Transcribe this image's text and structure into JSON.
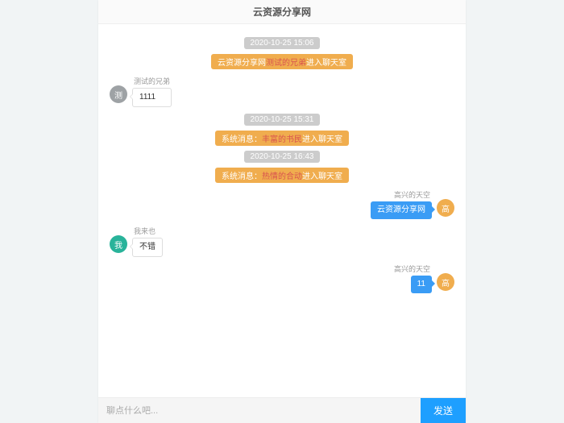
{
  "header": {
    "title": "云资源分享网"
  },
  "timeline": [
    {
      "kind": "sys",
      "style": "gray",
      "text": "2020-10-25 15:06"
    },
    {
      "kind": "sys",
      "style": "orange",
      "prefix": "云资源分享网",
      "hl": "测试的兄弟",
      "suffix": "进入聊天室"
    },
    {
      "kind": "msg",
      "side": "left",
      "avatarText": "测",
      "avatarClass": "av-gray",
      "name": "测试的兄弟",
      "bubbleClass": "b-gray",
      "text": "1111"
    },
    {
      "kind": "sys",
      "style": "gray",
      "text": "2020-10-25 15:31"
    },
    {
      "kind": "sys",
      "style": "orange",
      "prefix": "系统消息：",
      "hl": "丰富的书民",
      "suffix": "进入聊天室"
    },
    {
      "kind": "sys",
      "style": "gray",
      "text": "2020-10-25 16:43"
    },
    {
      "kind": "sys",
      "style": "orange",
      "prefix": "系统消息：",
      "hl": "热情的合动",
      "suffix": "进入聊天室"
    },
    {
      "kind": "msg",
      "side": "right",
      "avatarText": "高",
      "avatarClass": "av-orange",
      "name": "高兴的天空",
      "bubbleClass": "b-blue",
      "text": "云资源分享网"
    },
    {
      "kind": "msg",
      "side": "left",
      "avatarText": "我",
      "avatarClass": "av-teal",
      "name": "我来也",
      "bubbleClass": "b-gray",
      "text": "不错"
    },
    {
      "kind": "msg",
      "side": "right",
      "avatarText": "高",
      "avatarClass": "av-orange",
      "name": "高兴的天空",
      "bubbleClass": "b-blue",
      "text": "11"
    }
  ],
  "footer": {
    "placeholder": "聊点什么吧...",
    "value": "",
    "send_label": "发送"
  }
}
